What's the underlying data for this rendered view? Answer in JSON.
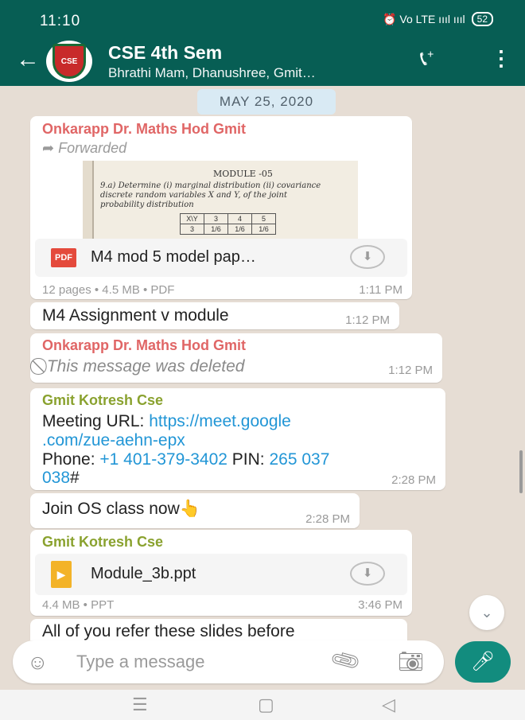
{
  "status_bar": {
    "time": "11:10",
    "icons": "⏰ Vo LTE ıııl ıııl",
    "battery": "52"
  },
  "header": {
    "title": "CSE 4th Sem",
    "subtitle": "Bhrathi Mam, Dhanushree, Gmit…",
    "avatar_text": "CSE"
  },
  "date_chip": "MAY 25, 2020",
  "messages": {
    "m1": {
      "sender": "Onkarapp Dr. Maths Hod Gmit",
      "forwarded": "Forwarded",
      "thumb": {
        "title": "MODULE -05",
        "line1": "9.a) Determine (i) marginal distribution (ii) covariance",
        "line2": "discrete random variables X and Y, of the joint",
        "line3": "probability distribution",
        "table": [
          [
            "X\\Y",
            "3",
            "4",
            "5"
          ],
          [
            "3",
            "1/6",
            "1/6",
            "1/6"
          ]
        ]
      },
      "file_icon": "PDF",
      "file_name": "M4 mod 5 model pap…",
      "meta": "12 pages • 4.5 MB • PDF",
      "time": "1:11 PM"
    },
    "m2": {
      "text": "M4 Assignment v module",
      "time": "1:12 PM"
    },
    "m3": {
      "sender": "Onkarapp Dr. Maths Hod Gmit",
      "text": "This message was deleted",
      "time": "1:12 PM"
    },
    "m4": {
      "sender": "Gmit Kotresh Cse",
      "url_label": "Meeting URL: ",
      "url_1": "https://meet.google",
      "url_2": ".com/zue-aehn-epx",
      "phone_label": "Phone: ",
      "phone": "+1 401-379-3402",
      "pin_label": " PIN: ",
      "pin_1": "265 037",
      "pin_2": "038",
      "pin_suffix": "#",
      "time": "2:28 PM"
    },
    "m5": {
      "text": "Join OS class now",
      "emoji": "👆",
      "time": "2:28 PM"
    },
    "m6": {
      "sender": "Gmit Kotresh Cse",
      "file_name": "Module_3b.ppt",
      "meta": "4.4 MB • PPT",
      "time": "3:46 PM"
    },
    "m7": {
      "text": "All of you refer these slides before"
    }
  },
  "input": {
    "placeholder": "Type a message"
  },
  "nav": {
    "recents": "☰",
    "home": "▢",
    "back": "◁"
  }
}
